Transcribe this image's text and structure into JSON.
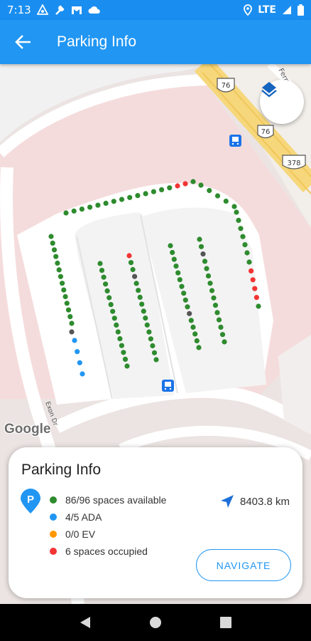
{
  "status_bar": {
    "time": "7:13",
    "left_icons": [
      "android-auto-icon",
      "wrench-icon",
      "gmail-icon",
      "cloud-icon"
    ],
    "network": "LTE",
    "right_icons": [
      "location-icon",
      "signal-icon",
      "battery-icon"
    ]
  },
  "app_bar": {
    "title": "Parking Info",
    "back_icon": "arrow-left-icon",
    "background_color": "#2196f3"
  },
  "map": {
    "attribution": "Google",
    "road_labels": [
      "Exon Dr",
      "Ferry Rd"
    ],
    "route_shields": [
      "76",
      "76",
      "378"
    ],
    "layers_icon": "layers-icon",
    "transit_icon": "bus-icon",
    "space_colors": {
      "available": "#2e8b2e",
      "ada": "#2196f3",
      "ev": "#ff9800",
      "occupied": "#f23434",
      "unknown": "#555555"
    }
  },
  "card": {
    "title": "Parking Info",
    "parking_icon": "parking-pin-icon",
    "legend": [
      {
        "label": "86/96 spaces available",
        "color": "#2e8b2e"
      },
      {
        "label": "4/5 ADA",
        "color": "#2196f3"
      },
      {
        "label": "0/0 EV",
        "color": "#ff9800"
      },
      {
        "label": "6 spaces occupied",
        "color": "#f23434"
      }
    ],
    "distance": "8403.8 km",
    "distance_icon": "navigation-arrow-icon",
    "navigate_label": "NAVIGATE"
  },
  "nav_bar": {
    "buttons": [
      "back-triangle-icon",
      "home-circle-icon",
      "recents-square-icon"
    ]
  }
}
